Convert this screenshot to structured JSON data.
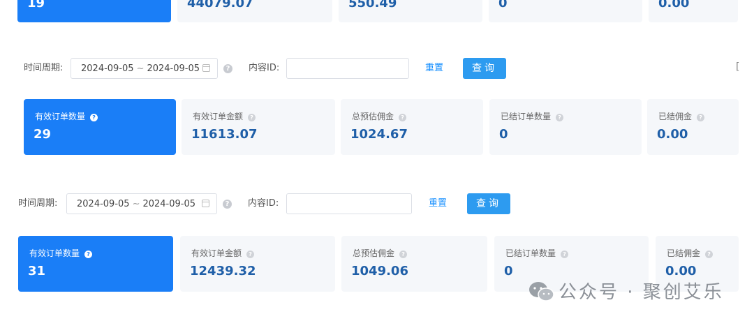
{
  "sections": [
    {
      "cards": [
        {
          "label": "",
          "value": "19"
        },
        {
          "label": "",
          "value": "44079.07"
        },
        {
          "label": "",
          "value": "550.49"
        },
        {
          "label": "",
          "value": "0"
        },
        {
          "label": "",
          "value": "0.00"
        }
      ]
    },
    {
      "filter": {
        "period_label": "时间周期:",
        "date_start": "2024-09-05",
        "date_sep": "~",
        "date_end": "2024-09-05",
        "content_id_label": "内容ID:",
        "content_id_value": "",
        "reset_label": "重置",
        "query_label": "查询"
      },
      "cards": [
        {
          "label": "有效订单数量",
          "value": "29"
        },
        {
          "label": "有效订单金额",
          "value": "11613.07"
        },
        {
          "label": "总预估佣金",
          "value": "1024.67"
        },
        {
          "label": "已结订单数量",
          "value": "0"
        },
        {
          "label": "已结佣金",
          "value": "0.00"
        }
      ]
    },
    {
      "filter": {
        "period_label": "时间周期:",
        "date_start": "2024-09-05",
        "date_sep": "~",
        "date_end": "2024-09-05",
        "content_id_label": "内容ID:",
        "content_id_value": "",
        "reset_label": "重置",
        "query_label": "查询"
      },
      "cards": [
        {
          "label": "有效订单数量",
          "value": "31"
        },
        {
          "label": "有效订单金额",
          "value": "12439.32"
        },
        {
          "label": "总预估佣金",
          "value": "1049.06"
        },
        {
          "label": "已结订单数量",
          "value": "0"
        },
        {
          "label": "已结佣金",
          "value": "0.00"
        }
      ]
    }
  ],
  "edge_bracket": "[",
  "watermark": {
    "text": "公众号 · 聚创艾乐",
    "icon": "wechat-icon"
  },
  "colors": {
    "primary_card": "#1a7ef7",
    "query_button": "#2d9bf0",
    "value_text": "#1f5fa8",
    "card_bg": "#f5f7fa",
    "link": "#1890ff"
  }
}
